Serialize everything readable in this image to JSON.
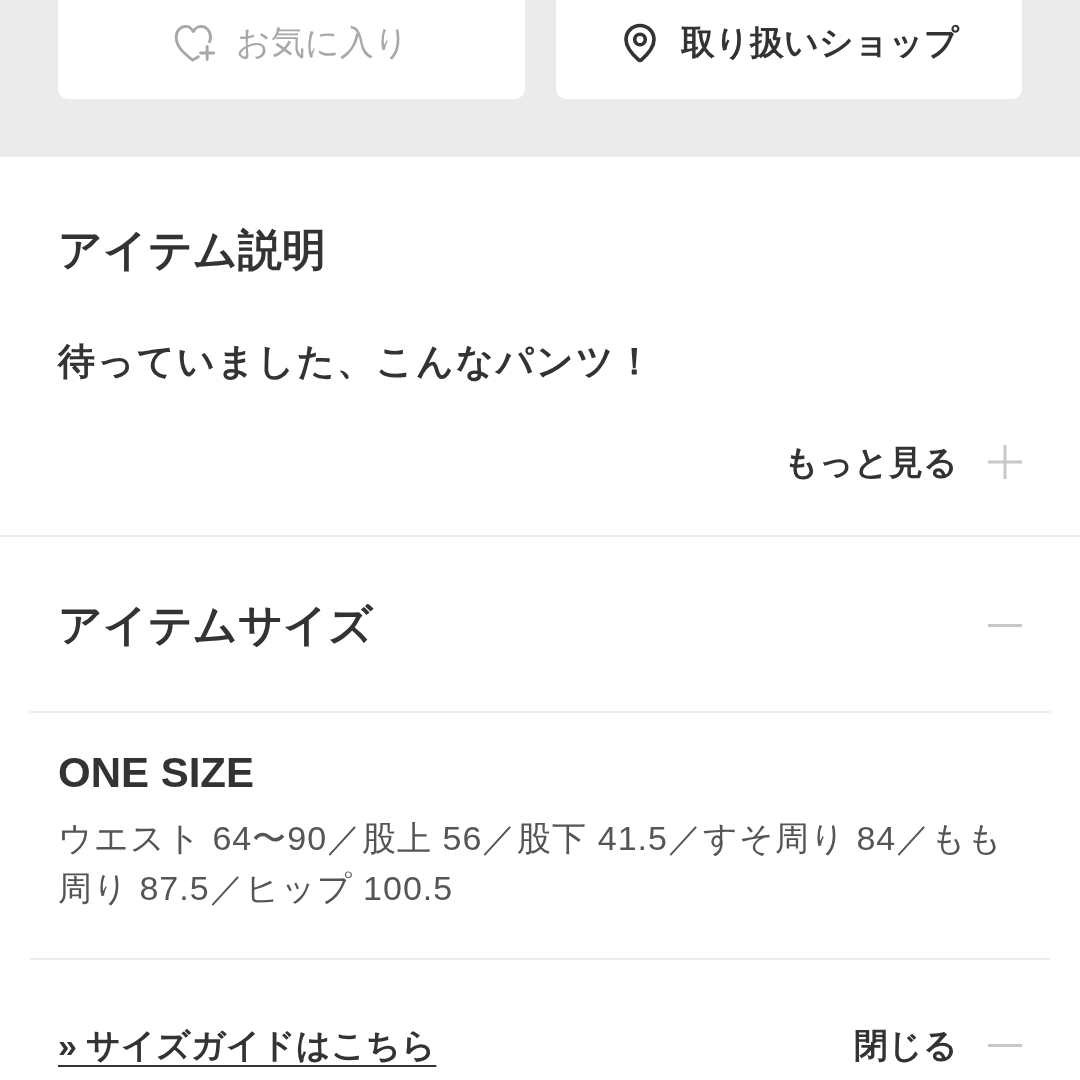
{
  "actions": [
    {
      "kind": "favorite",
      "label": "お気に入り",
      "disabled": true
    },
    {
      "kind": "shop",
      "label": "取り扱いショップ",
      "disabled": false
    }
  ],
  "description": {
    "title": "アイテム説明",
    "text": "待っていました、こんなパンツ！",
    "more_label": "もっと見る",
    "expanded": false
  },
  "size": {
    "title": "アイテムサイズ",
    "expanded": true,
    "sizes": [
      {
        "name": "ONE SIZE",
        "measurements": "ウエスト 64〜90／股上 56／股下 41.5／すそ周り 84／もも周り 87.5／ヒップ 100.5"
      }
    ],
    "guide_link": "» サイズガイドはこちら",
    "close_label": "閉じる"
  }
}
